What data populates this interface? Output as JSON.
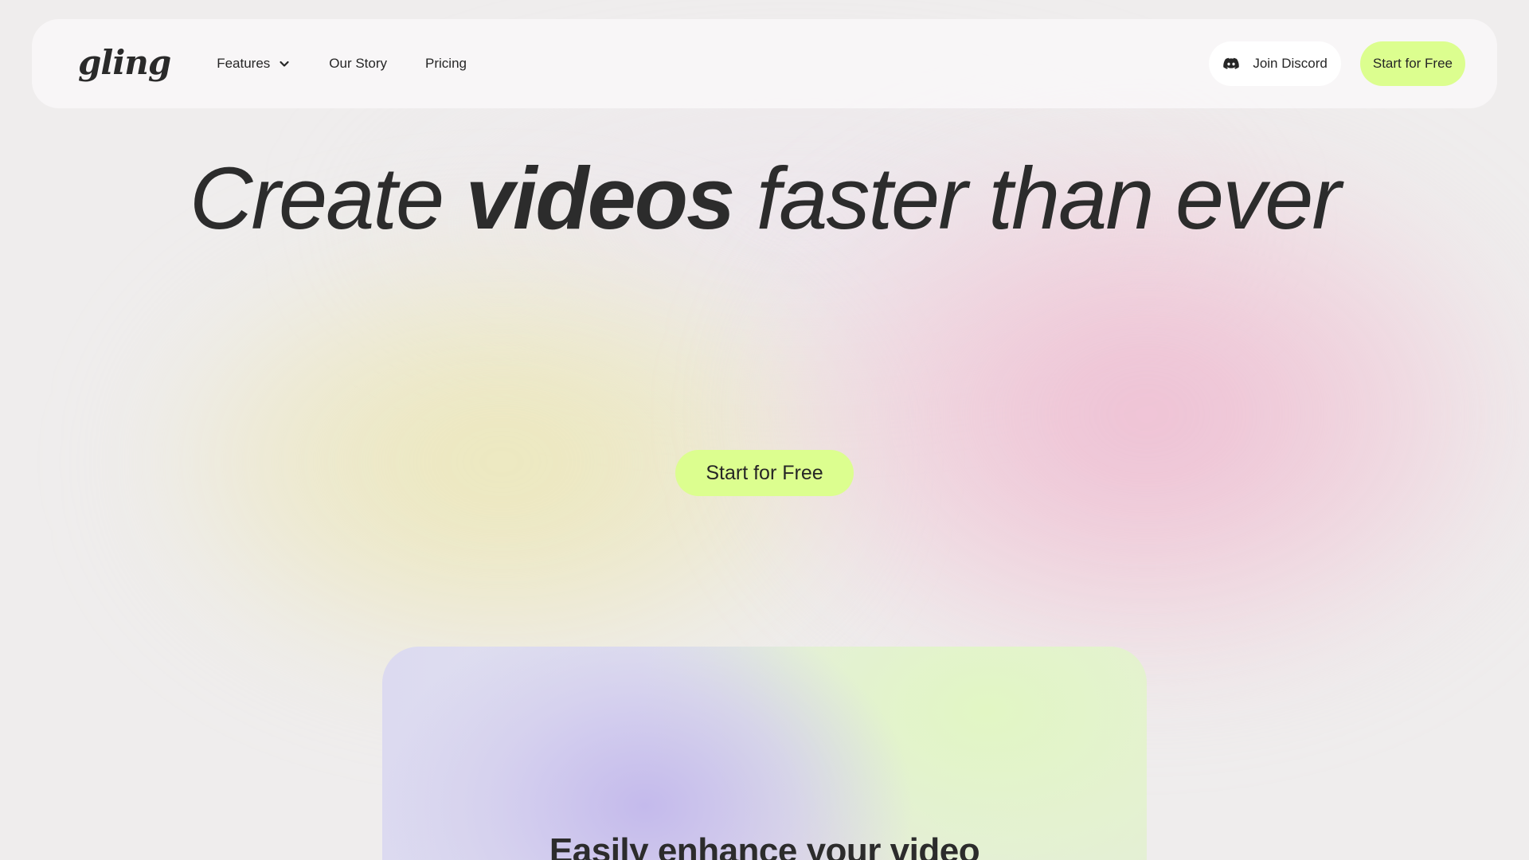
{
  "brand": {
    "logo_text": "gling"
  },
  "nav": {
    "links": [
      {
        "label": "Features",
        "has_dropdown": true
      },
      {
        "label": "Our Story"
      },
      {
        "label": "Pricing"
      }
    ],
    "discord_label": "Join Discord",
    "start_label": "Start for Free"
  },
  "hero": {
    "title_part1": "Create ",
    "title_bold": "videos",
    "title_part2": " faster than ever",
    "cta_label": "Start for Free"
  },
  "card": {
    "title": "Easily enhance your video"
  },
  "colors": {
    "accent": "#dcfe8f",
    "text": "#262626",
    "background": "#efeded"
  },
  "icons": {
    "features_chevron": "chevron-down-icon",
    "discord": "discord-icon"
  }
}
